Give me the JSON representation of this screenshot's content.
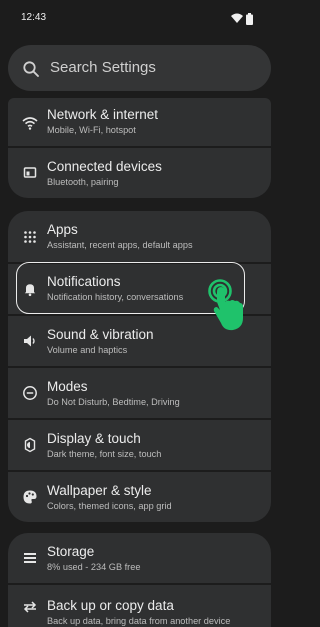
{
  "status_bar": {
    "time": "12:43",
    "icons": [
      "wifi-icon",
      "battery-icon"
    ]
  },
  "search": {
    "placeholder": "Search Settings",
    "icon": "search-icon"
  },
  "settings": [
    {
      "id": "network",
      "title": "Network & internet",
      "subtitle": "Mobile, Wi-Fi, hotspot",
      "icon": "wifi-icon"
    },
    {
      "id": "connected-devices",
      "title": "Connected devices",
      "subtitle": "Bluetooth, pairing",
      "icon": "devices-icon"
    },
    {
      "id": "apps",
      "title": "Apps",
      "subtitle": "Assistant, recent apps, default apps",
      "icon": "apps-grid-icon"
    },
    {
      "id": "notifications",
      "title": "Notifications",
      "subtitle": "Notification history, conversations",
      "icon": "bell-icon"
    },
    {
      "id": "sound",
      "title": "Sound & vibration",
      "subtitle": "Volume and haptics",
      "icon": "speaker-icon"
    },
    {
      "id": "modes",
      "title": "Modes",
      "subtitle": "Do Not Disturb, Bedtime, Driving",
      "icon": "do-not-disturb-icon"
    },
    {
      "id": "display",
      "title": "Display & touch",
      "subtitle": "Dark theme, font size, touch",
      "icon": "display-icon"
    },
    {
      "id": "wallpaper",
      "title": "Wallpaper & style",
      "subtitle": "Colors, themed icons, app grid",
      "icon": "palette-icon"
    },
    {
      "id": "storage",
      "title": "Storage",
      "subtitle": "8% used - 234 GB free",
      "icon": "storage-icon"
    },
    {
      "id": "backup",
      "title": "Back up or copy data",
      "subtitle": "Back up data, bring data from another device",
      "icon": "transfer-icon"
    }
  ],
  "tap_indicator": {
    "target": "notifications",
    "icon": "tap-hand-icon"
  },
  "colors": {
    "background": "#1c1c1c",
    "card": "#2f3031",
    "accent_green": "#1fc26b"
  }
}
